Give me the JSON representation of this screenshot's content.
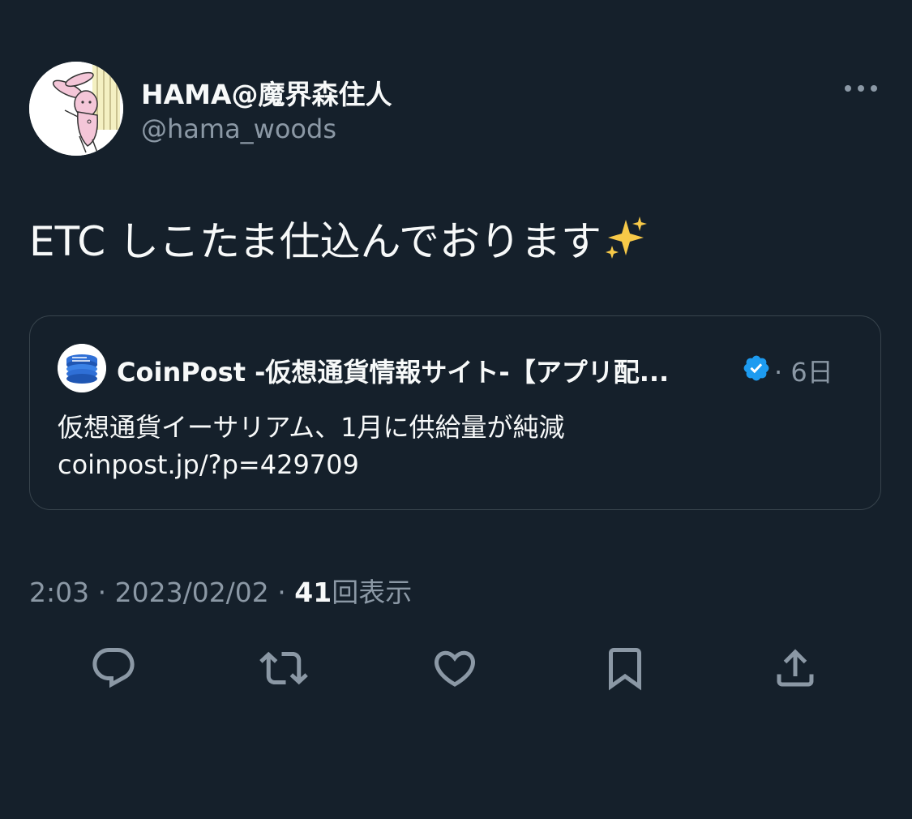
{
  "tweet": {
    "display_name": "HAMA@魔界森住人",
    "handle": "@hama_woods",
    "avatar_icon": "bunny-avatar-icon",
    "more_icon": "more-options-icon",
    "text": "ETC しこたま仕込んでおります",
    "emoji": "sparkles-icon"
  },
  "quote": {
    "avatar_icon": "coinpost-logo-icon",
    "name": "CoinPost -仮想通貨情報サイト-【アプリ配...",
    "verified_icon": "verified-badge-icon",
    "time": "· 6日",
    "line1": "仮想通貨イーサリアム、1月に供給量が純減",
    "line2": "coinpost.jp/?p=429709"
  },
  "meta": {
    "time": "2:03",
    "separator": " · ",
    "date": "2023/02/02",
    "views_count": "41",
    "views_label": "回表示"
  },
  "actions": [
    {
      "name": "reply",
      "icon": "reply-icon"
    },
    {
      "name": "retweet",
      "icon": "retweet-icon"
    },
    {
      "name": "like",
      "icon": "heart-icon"
    },
    {
      "name": "bookmark",
      "icon": "bookmark-icon"
    },
    {
      "name": "share",
      "icon": "share-icon"
    }
  ],
  "colors": {
    "background": "#15202b",
    "primary_text": "#f7f9f9",
    "secondary_text": "#8b98a5",
    "border": "#38444d",
    "verified": "#1d9bf0"
  }
}
